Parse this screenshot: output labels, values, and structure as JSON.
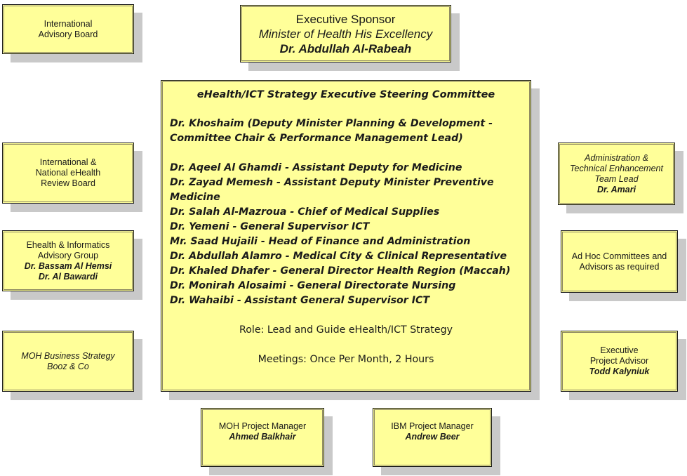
{
  "colors": {
    "box_fill": "#ffff99",
    "box_border": "#1a1a1a",
    "box_inner_border": "#8a8560",
    "shadow": "#c9c9c9",
    "text": "#1a1a1a"
  },
  "sponsor": {
    "role": "Executive Sponsor",
    "title": "Minister of Health His Excellency",
    "name": "Dr. Abdullah Al-Rabeah"
  },
  "committee": {
    "title": "eHealth/ICT Strategy  Executive Steering Committee",
    "chair_line1": "Dr. Khoshaim (Deputy Minister Planning & Development -",
    "chair_line2": "Committee Chair & Performance Management Lead)",
    "members": [
      "Dr. Aqeel Al Ghamdi - Assistant Deputy for Medicine",
      "Dr. Zayad Memesh - Assistant Deputy Minister Preventive",
      "Medicine",
      "Dr. Salah Al-Mazroua - Chief of Medical Supplies",
      "Dr. Yemeni - General Supervisor ICT",
      "Mr. Saad Hujaili - Head of Finance and Administration",
      "Dr. Abdullah Alamro - Medical City & Clinical Representative",
      "Dr. Khaled Dhafer - General Director Health Region (Maccah)",
      "Dr. Monirah Alosaimi - General Directorate Nursing",
      "Dr. Wahaibi - Assistant General Supervisor ICT"
    ],
    "role": "Role:  Lead and Guide eHealth/ICT Strategy",
    "meetings": "Meetings:  Once Per Month, 2 Hours"
  },
  "left_boxes": {
    "intl_advisory": [
      "International",
      "Advisory Board"
    ],
    "review_board": [
      "International &",
      "National eHealth",
      "Review Board"
    ],
    "ehealth_group": {
      "lines": [
        "Ehealth & Informatics",
        "Advisory Group"
      ],
      "names": [
        "Dr. Bassam Al Hemsi",
        "Dr. Al Bawardi"
      ]
    },
    "business_strategy": [
      "MOH Business Strategy",
      "Booz & Co"
    ]
  },
  "right_boxes": {
    "admin_tech": {
      "lines": [
        "Administration &",
        "Technical Enhancement",
        "Team Lead"
      ],
      "name": "Dr. Amari"
    },
    "adhoc": [
      "Ad Hoc Committees and",
      "Advisors as required"
    ],
    "exec_advisor": {
      "lines": [
        "Executive",
        "Project Advisor"
      ],
      "name": "Todd Kalyniuk"
    }
  },
  "bottom_boxes": {
    "moh_pm": {
      "role": "MOH Project Manager",
      "name": "Ahmed Balkhair"
    },
    "ibm_pm": {
      "role": "IBM Project Manager",
      "name": "Andrew Beer"
    }
  }
}
